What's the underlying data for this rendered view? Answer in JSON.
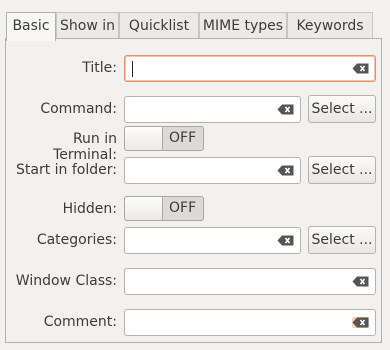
{
  "tabs": [
    {
      "label": "Basic",
      "active": true
    },
    {
      "label": "Show in"
    },
    {
      "label": "Quicklist"
    },
    {
      "label": "MIME types"
    },
    {
      "label": "Keywords"
    }
  ],
  "form": {
    "title_label": "Title:",
    "title_value": "",
    "command_label": "Command:",
    "command_value": "",
    "command_select": "Select ...",
    "terminal_label": "Run in Terminal:",
    "terminal_state": "OFF",
    "folder_label": "Start in folder:",
    "folder_value": "",
    "folder_select": "Select ...",
    "hidden_label": "Hidden:",
    "hidden_state": "OFF",
    "categories_label": "Categories:",
    "categories_value": "",
    "categories_select": "Select ...",
    "window_class_label": "Window Class:",
    "window_class_value": "",
    "comment_label": "Comment:",
    "comment_value": ""
  },
  "colors": {
    "focus_border": "#e88f6b",
    "background": "#f2f1f0"
  },
  "icons": {
    "clear": "clear-entry-icon"
  }
}
